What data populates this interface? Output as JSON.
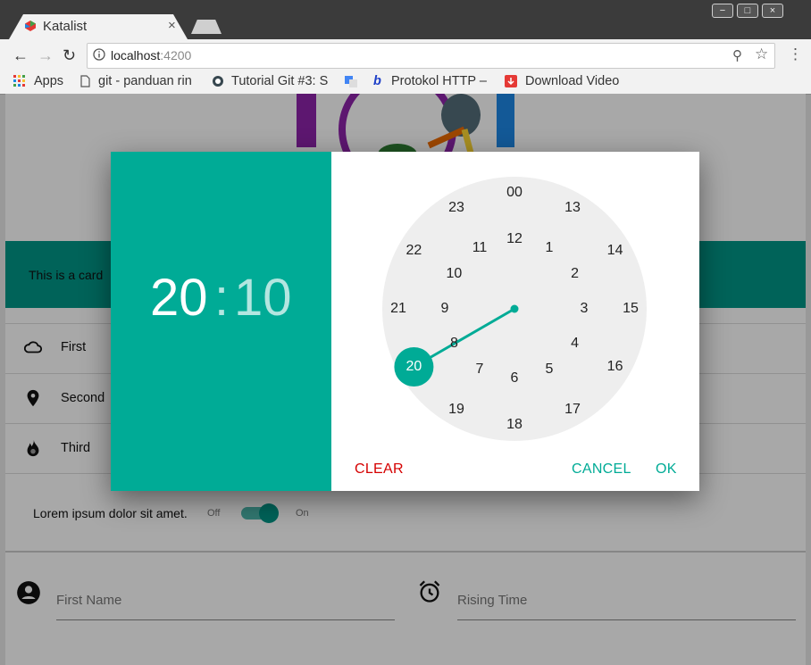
{
  "browser": {
    "tab_title": "Katalist",
    "tab_close": "×",
    "url_host": "localhost",
    "url_port": ":4200",
    "bookmarks": [
      {
        "label": "Apps",
        "icon": "apps-grid-icon"
      },
      {
        "label": "git - panduan rin",
        "icon": "page-icon"
      },
      {
        "label": "Tutorial Git #3: S",
        "icon": "globe-icon"
      },
      {
        "label": "",
        "icon": "translate-icon"
      },
      {
        "label": "Protokol HTTP –",
        "icon": "b-icon"
      },
      {
        "label": "Download Video",
        "icon": "download-icon"
      }
    ],
    "win_buttons": [
      "−",
      "□",
      "×"
    ]
  },
  "page": {
    "card_text": "This is a card",
    "list": [
      {
        "label": "First",
        "icon": "cloud-icon"
      },
      {
        "label": "Second",
        "icon": "location-pin-icon"
      },
      {
        "label": "Third",
        "icon": "flame-icon"
      }
    ],
    "toggle": {
      "label": "Lorem ipsum dolor sit amet.",
      "off": "Off",
      "on": "On"
    },
    "fields": [
      {
        "placeholder": "First Name",
        "icon": "account-circle-icon"
      },
      {
        "placeholder": "Rising Time",
        "icon": "alarm-clock-icon"
      }
    ]
  },
  "timepicker": {
    "hour": "20",
    "colon": ":",
    "minute": "10",
    "selected_hour": "20",
    "outer_ring": [
      "00",
      "1",
      "2",
      "3",
      "4",
      "5",
      "6",
      "7",
      "8",
      "9",
      "10",
      "11"
    ],
    "inner_ring": [
      "12",
      "13",
      "14",
      "15",
      "16",
      "17",
      "18",
      "19",
      "20",
      "21",
      "22",
      "23"
    ],
    "clear_label": "CLEAR",
    "cancel_label": "CANCEL",
    "ok_label": "OK",
    "colors": {
      "accent": "#00ab96",
      "clear": "#d50000",
      "face": "#eeeeee"
    }
  }
}
